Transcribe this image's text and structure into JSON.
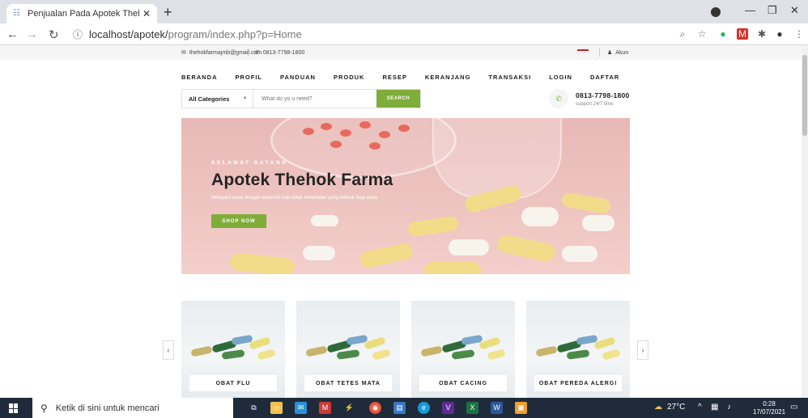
{
  "browser": {
    "tab_title": "Penjualan Pada Apotek Thehok F",
    "url_host": "localhost/apotek/",
    "url_path": "program/index.php?p=Home"
  },
  "topbar": {
    "email": "thehokfarmajmb@gmail.com",
    "phone": "0813-7798-1800",
    "account": "Akun"
  },
  "menu": {
    "items": [
      "BERANDA",
      "PROFIL",
      "PANDUAN",
      "PRODUK",
      "RESEP",
      "KERANJANG",
      "TRANSAKSI",
      "LOGIN",
      "DAFTAR"
    ]
  },
  "search": {
    "category": "All Categories",
    "placeholder": "What do yo u need?",
    "button": "SEARCH"
  },
  "contact": {
    "phone": "0813-7798-1800",
    "support": "support 24/7 time"
  },
  "hero": {
    "welcome": "SELAMAT DATANG",
    "title": "Apotek Thehok Farma",
    "description": "Melayani anda dengan sepenuh hati untuk kesehatan yang terbaik bagi anda",
    "button": "SHOP NOW"
  },
  "categories": {
    "items": [
      "OBAT FLU",
      "OBAT TETES MATA",
      "OBAT CACING",
      "OBAT PEREDA ALERGI"
    ],
    "prev": "‹",
    "next": "›"
  },
  "taskbar": {
    "search_placeholder": "Ketik di sini untuk mencari",
    "temperature": "27°C",
    "time": "0:28",
    "date": "17/07/2021"
  },
  "colors": {
    "accent": "#7fad39",
    "taskbar": "#1f2b3a"
  }
}
